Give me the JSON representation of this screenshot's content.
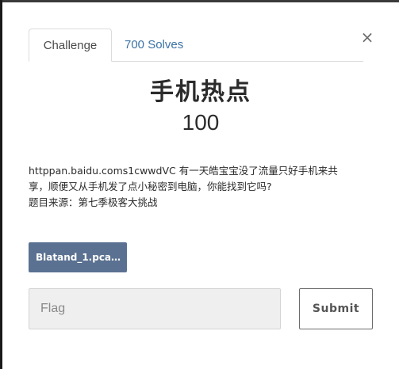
{
  "tabs": {
    "challenge_label": "Challenge",
    "solves_label": "700 Solves"
  },
  "close": {
    "symbol": "×"
  },
  "challenge": {
    "name": "手机热点",
    "value": "100",
    "description": [
      "httppan.baidu.coms1cwwdVC 有一天皓宝宝没了流量只好手机来共",
      "享，顺便又从手机发了点小秘密到电脑，你能找到它吗?",
      "题目来源：第七季极客大挑战"
    ],
    "file_label": "Blatand_1.pcap..."
  },
  "form": {
    "flag_placeholder": "Flag",
    "submit_label": "Submit"
  },
  "colors": {
    "file_button": "#5a7191",
    "tab_link": "#3a72a6"
  }
}
